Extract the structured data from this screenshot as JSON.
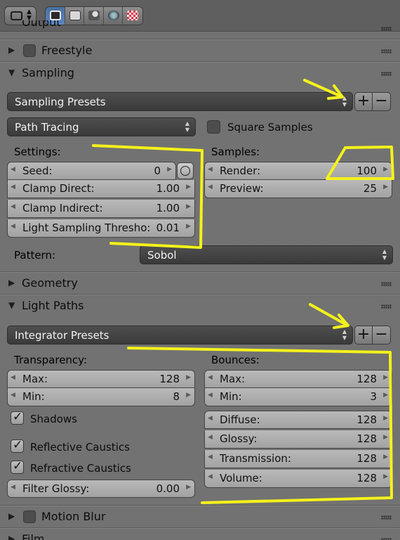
{
  "icons": [
    "editor-type-icon",
    "camera-icon",
    "render-layers-icon",
    "scene-icon",
    "world-icon",
    "texture-icon",
    "plus-icon",
    "minus-icon",
    "seed-clock-icon",
    "drag-grip-icon"
  ],
  "colors": {
    "annotation": "#f4f21a",
    "accent": "#5680c2"
  },
  "panels": {
    "output": {
      "title": "Output"
    },
    "freestyle": {
      "title": "Freestyle",
      "enabled": false
    },
    "sampling": {
      "title": "Sampling"
    },
    "geometry": {
      "title": "Geometry"
    },
    "light_paths": {
      "title": "Light Paths"
    },
    "motion_blur": {
      "title": "Motion Blur",
      "enabled": false
    },
    "film": {
      "title": "Film"
    }
  },
  "sampling": {
    "presets_label": "Sampling Presets",
    "integrator": "Path Tracing",
    "square_samples": {
      "label": "Square Samples",
      "checked": false
    },
    "settings_label": "Settings:",
    "samples_label": "Samples:",
    "seed": {
      "label": "Seed:",
      "value": "0"
    },
    "clamp_direct": {
      "label": "Clamp Direct:",
      "value": "1.00"
    },
    "clamp_indirect": {
      "label": "Clamp Indirect:",
      "value": "1.00"
    },
    "light_threshold": {
      "label": "Light Sampling Thresho:",
      "value": "0.01"
    },
    "render": {
      "label": "Render:",
      "value": "100"
    },
    "preview": {
      "label": "Preview:",
      "value": "25"
    },
    "pattern_label": "Pattern:",
    "pattern_value": "Sobol"
  },
  "light_paths": {
    "presets_label": "Integrator Presets",
    "transparency_label": "Transparency:",
    "bounces_label": "Bounces:",
    "t_max": {
      "label": "Max:",
      "value": "128"
    },
    "t_min": {
      "label": "Min:",
      "value": "8"
    },
    "b_max": {
      "label": "Max:",
      "value": "128"
    },
    "b_min": {
      "label": "Min:",
      "value": "3"
    },
    "shadows": {
      "label": "Shadows",
      "checked": true
    },
    "reflective": {
      "label": "Reflective Caustics",
      "checked": true
    },
    "refractive": {
      "label": "Refractive Caustics",
      "checked": true
    },
    "filter_glossy": {
      "label": "Filter Glossy:",
      "value": "0.00"
    },
    "diffuse": {
      "label": "Diffuse:",
      "value": "128"
    },
    "glossy": {
      "label": "Glossy:",
      "value": "128"
    },
    "transmission": {
      "label": "Transmission:",
      "value": "128"
    },
    "volume": {
      "label": "Volume:",
      "value": "128"
    }
  }
}
